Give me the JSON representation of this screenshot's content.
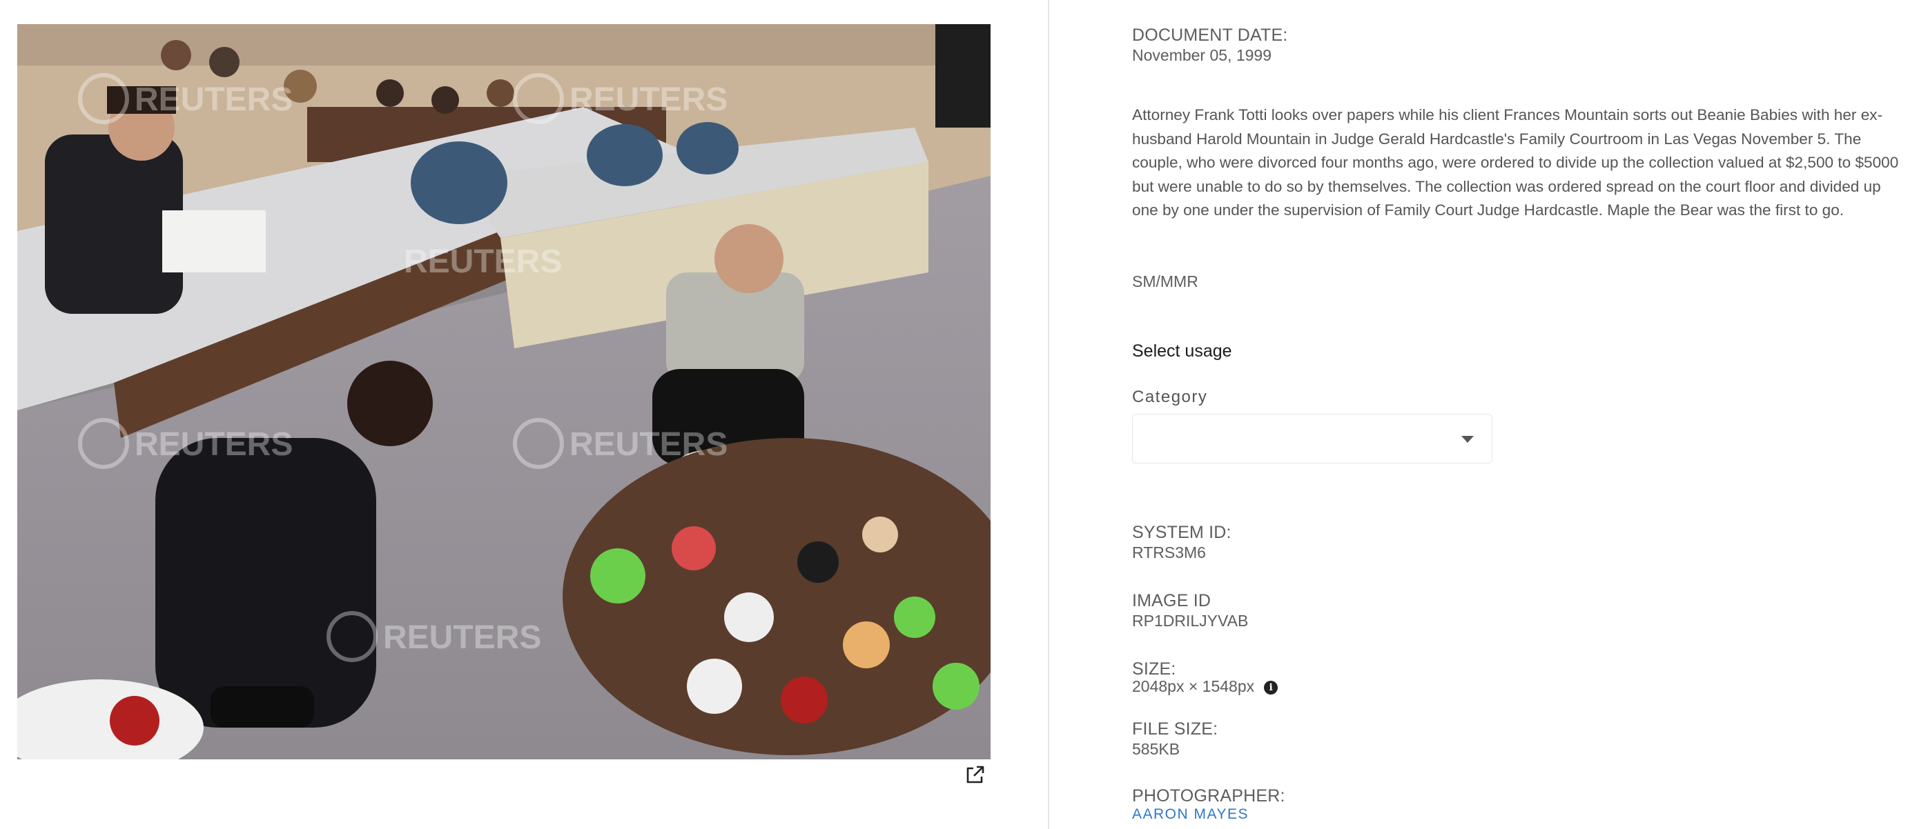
{
  "photo": {
    "description_icon": "photo",
    "watermark_text": "REUTERS"
  },
  "actions": {
    "open_external_icon": "external-link-icon"
  },
  "document_date": {
    "label": "DOCUMENT DATE:",
    "value": "November 05, 1999"
  },
  "caption": "Attorney Frank Totti looks over papers while his client Frances Mountain sorts out Beanie Babies with her ex-husband Harold Mountain in Judge Gerald Hardcastle's Family Courtroom in Las Vegas November 5. The couple, who were divorced four months ago, were ordered to divide up the collection valued at $2,500 to $5000 but were unable to do so by themselves. The collection was ordered spread on the court floor and divided up one by one under the supervision of Family Court Judge Hardcastle. Maple the Bear was the first to go.",
  "credit_code": "SM/MMR",
  "usage": {
    "heading": "Select usage",
    "category_label": "Category",
    "category_value": ""
  },
  "system_id": {
    "label": "SYSTEM ID:",
    "value": "RTRS3M6"
  },
  "image_id": {
    "label": "IMAGE ID",
    "value": "RP1DRILJYVAB"
  },
  "size": {
    "label": "SIZE:",
    "value": "2048px × 1548px",
    "info_icon": "info-icon"
  },
  "file_size": {
    "label": "FILE SIZE:",
    "value": "585KB"
  },
  "photographer": {
    "label": "PHOTOGRAPHER:",
    "value": "AARON MAYES"
  },
  "colors": {
    "link": "#2f77c9",
    "text": "#5d5d5d",
    "divider": "#e4e4e4"
  }
}
